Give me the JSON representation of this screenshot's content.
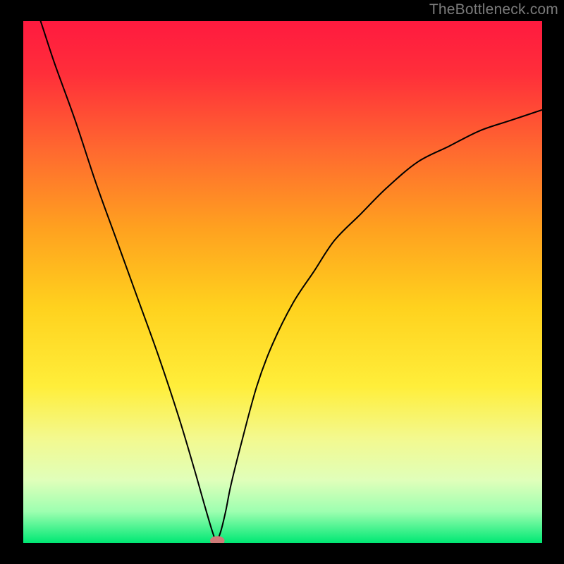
{
  "watermark": "TheBottleneck.com",
  "chart_data": {
    "type": "line",
    "title": "",
    "xlabel": "",
    "ylabel": "",
    "xlim": [
      0,
      100
    ],
    "ylim": [
      0,
      100
    ],
    "background": "rainbow-gradient",
    "gradient_stops": [
      {
        "offset": 0.0,
        "color": "#ff1a3f"
      },
      {
        "offset": 0.1,
        "color": "#ff2e3a"
      },
      {
        "offset": 0.25,
        "color": "#ff6a2f"
      },
      {
        "offset": 0.4,
        "color": "#ffa21f"
      },
      {
        "offset": 0.55,
        "color": "#ffd21e"
      },
      {
        "offset": 0.7,
        "color": "#ffee3a"
      },
      {
        "offset": 0.8,
        "color": "#f3f98f"
      },
      {
        "offset": 0.88,
        "color": "#e0ffba"
      },
      {
        "offset": 0.94,
        "color": "#9dffb0"
      },
      {
        "offset": 1.0,
        "color": "#00e874"
      }
    ],
    "series": [
      {
        "name": "bottleneck-curve",
        "color": "#000000",
        "stroke_width": 2,
        "x": [
          0.0,
          3,
          6,
          10,
          14,
          18,
          22,
          26,
          30,
          33,
          35,
          36.5,
          37.2,
          38,
          39,
          40,
          42,
          45,
          48,
          52,
          56,
          60,
          65,
          70,
          76,
          82,
          88,
          94,
          100
        ],
        "values": [
          109,
          101,
          92,
          81,
          69,
          58,
          47,
          36,
          24,
          14,
          7,
          2,
          0.5,
          2,
          6,
          11,
          19,
          30,
          38,
          46,
          52,
          58,
          63,
          68,
          73,
          76,
          79,
          81,
          83
        ]
      }
    ],
    "marker": {
      "name": "min-marker",
      "shape": "pill",
      "x": 37.4,
      "y": 0.4,
      "rx": 1.4,
      "ry": 0.9,
      "fill": "#cf7b78"
    }
  }
}
